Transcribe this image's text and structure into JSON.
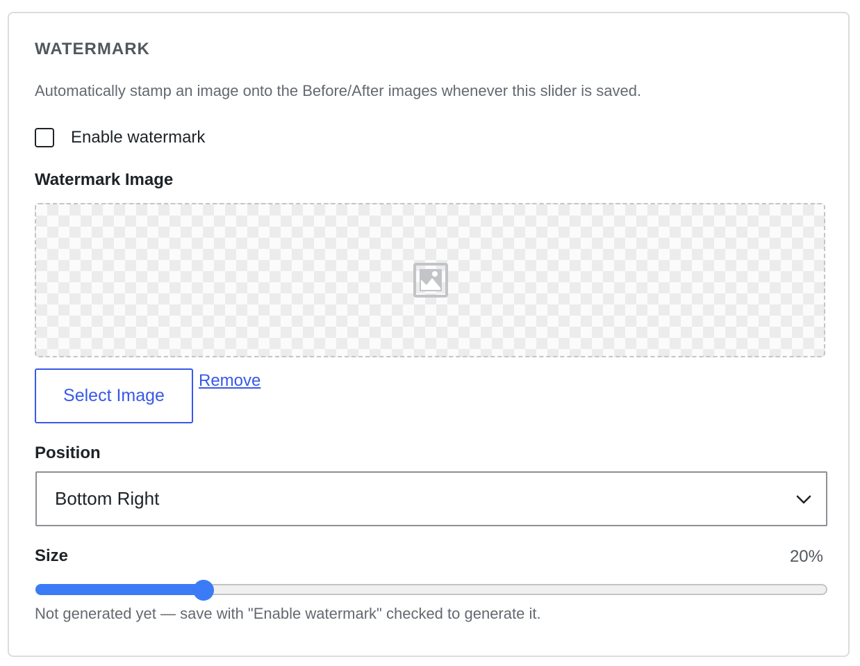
{
  "section": {
    "title": "WATERMARK",
    "description": "Automatically stamp an image onto the Before/After images whenever this slider is saved."
  },
  "enable_watermark": {
    "label": "Enable watermark",
    "checked": false
  },
  "watermark_image": {
    "label": "Watermark Image",
    "placeholder_icon": "image-placeholder-icon",
    "select_button_label": "Select Image",
    "remove_link_label": "Remove"
  },
  "position": {
    "label": "Position",
    "selected": "Bottom Right"
  },
  "size": {
    "label": "Size",
    "value_text": "20%",
    "value": 20,
    "min": 0,
    "max": 100
  },
  "status": {
    "help_text": "Not generated yet — save with \"Enable watermark\" checked to generate it."
  },
  "colors": {
    "accent": "#3858e9",
    "slider": "#3b7cf6",
    "border": "#dcdcde"
  }
}
